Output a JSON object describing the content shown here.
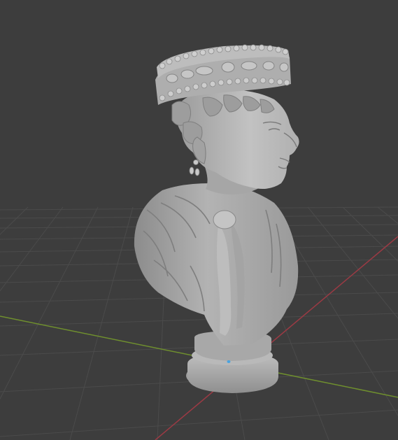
{
  "app": "3D viewport",
  "viewport": {
    "background": "#3d3d3d",
    "grid_color": "#4b4b4b",
    "axis_x_color": "#9c3a44",
    "axis_y_color": "#6f8f2e",
    "origin_color": "#4aa3df",
    "model_color": "#a9a9a9"
  },
  "model": {
    "name": "marble-bust",
    "description_visible": false
  }
}
